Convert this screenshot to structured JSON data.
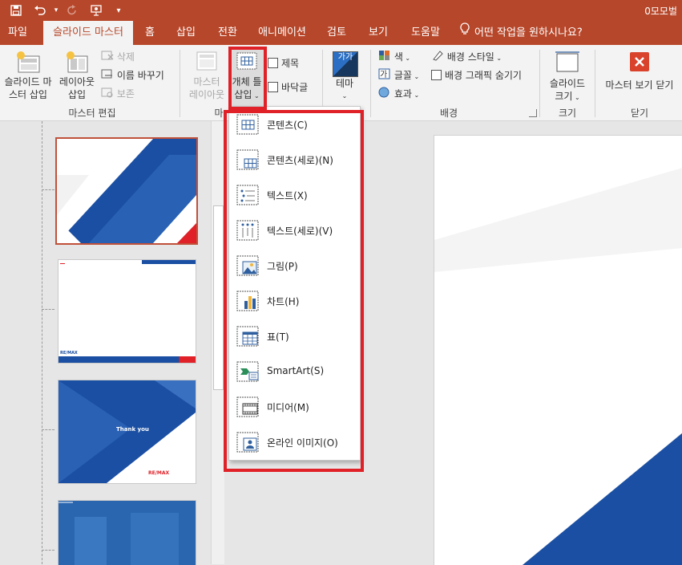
{
  "titlebar": {
    "document_title": "0모모벌",
    "qat_icons": [
      "save-icon",
      "undo-icon",
      "redo-icon",
      "present-icon",
      "customize-icon"
    ]
  },
  "tabs": [
    "파일",
    "슬라이드 마스터",
    "홈",
    "삽입",
    "전환",
    "애니메이션",
    "검토",
    "보기",
    "도움말"
  ],
  "active_tab": "슬라이드 마스터",
  "tell_me": "어떤 작업을 원하시나요?",
  "ribbon": {
    "master_edit": {
      "insert_slide_master_l1": "슬라이드 마",
      "insert_slide_master_l2": "스터 삽입",
      "insert_layout_l1": "레이아웃",
      "insert_layout_l2": "삽입",
      "delete": "삭제",
      "rename": "이름 바꾸기",
      "preserve": "보존",
      "label": "마스터 편집"
    },
    "master_layout": {
      "master_layout_l1": "마스터",
      "master_layout_l2": "레이아웃",
      "insert_placeholder_l1": "개체 틀",
      "insert_placeholder_l2": "삽입",
      "title": "제목",
      "footer": "바닥글",
      "label_partial": "마"
    },
    "edit_theme": {
      "theme": "테마",
      "theme_icon_text": "가가"
    },
    "background": {
      "colors": "색",
      "fonts": "글꼴",
      "effects": "효과",
      "bg_styles": "배경 스타일",
      "hide_bg": "배경 그래픽 숨기기",
      "label": "배경"
    },
    "size": {
      "slide_size_l1": "슬라이드",
      "slide_size_l2": "크기",
      "label": "크기"
    },
    "close": {
      "close_master": "마스터 보기 닫기",
      "label": "닫기"
    }
  },
  "placeholder_menu": {
    "items": [
      {
        "label": "콘텐츠(C)",
        "icon": "content-icon"
      },
      {
        "label": "콘텐츠(세로)(N)",
        "icon": "content-vertical-icon"
      },
      {
        "label": "텍스트(X)",
        "icon": "text-icon"
      },
      {
        "label": "텍스트(세로)(V)",
        "icon": "text-vertical-icon"
      },
      {
        "label": "그림(P)",
        "icon": "picture-icon"
      },
      {
        "label": "차트(H)",
        "icon": "chart-icon"
      },
      {
        "label": "표(T)",
        "icon": "table-icon"
      },
      {
        "label": "SmartArt(S)",
        "icon": "smartart-icon"
      },
      {
        "label": "미디어(M)",
        "icon": "media-icon"
      },
      {
        "label": "온라인 이미지(O)",
        "icon": "online-image-icon"
      }
    ]
  },
  "thumbnails": {
    "slide2_brand": "RE/MAX",
    "slide3_thanks": "Thank you",
    "slide3_brand": "RE/MAX"
  },
  "colors": {
    "accent": "#b7472a",
    "highlight": "#e02128",
    "slide_blue": "#1b4fa3"
  }
}
